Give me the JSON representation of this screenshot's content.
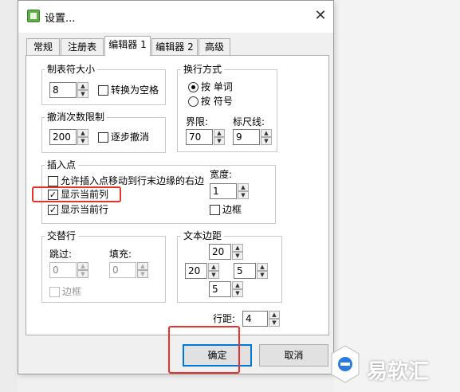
{
  "window": {
    "title": "设置...",
    "close_glyph": "✕",
    "app_icon": "settings-app-icon"
  },
  "tabs": [
    {
      "label": "常规",
      "active": false
    },
    {
      "label": "注册表",
      "active": false
    },
    {
      "label": "编辑器 1",
      "active": true
    },
    {
      "label": "编辑器 2",
      "active": false
    },
    {
      "label": "高级",
      "active": false
    }
  ],
  "tab_size": {
    "label": "制表符大小",
    "value": "8",
    "convert_label": "转换为空格",
    "convert_checked": false
  },
  "wrap": {
    "label": "换行方式",
    "by_word": "按 单词",
    "by_symbol": "按 符号",
    "selected": "by_word"
  },
  "limit": {
    "label": "界限:",
    "value": "70"
  },
  "ruler": {
    "label": "标尺线:",
    "value": "9"
  },
  "undo": {
    "label": "撤消次数限制",
    "value": "200",
    "step_label": "逐步撤消",
    "step_checked": false
  },
  "insert": {
    "label": "插入点",
    "allow_move_label": "允许插入点移动到行末边缘的右边",
    "allow_move_checked": false,
    "show_col_label": "显示当前列",
    "show_col_checked": true,
    "show_row_label": "显示当前行",
    "show_row_checked": true,
    "width_label": "宽度:",
    "width_value": "1",
    "border_label": "边框",
    "border_checked": false
  },
  "alternate": {
    "label": "交替行",
    "skip_label": "跳过:",
    "skip_value": "0",
    "fill_label": "填充:",
    "fill_value": "0",
    "border_label": "边框"
  },
  "margins": {
    "label": "文本边距",
    "top": "20",
    "left": "20",
    "right": "5",
    "bottom": "5"
  },
  "line_spacing": {
    "label": "行距:",
    "value": "4"
  },
  "buttons": {
    "ok": "确定",
    "cancel": "取消"
  },
  "spin": {
    "up": "▲",
    "down": "▼"
  },
  "check_mark": "✓",
  "watermark": {
    "text": "易软汇"
  },
  "colors": {
    "highlight": "#e8332a",
    "focus": "#0078d7",
    "icon_green": "#5fae48"
  }
}
